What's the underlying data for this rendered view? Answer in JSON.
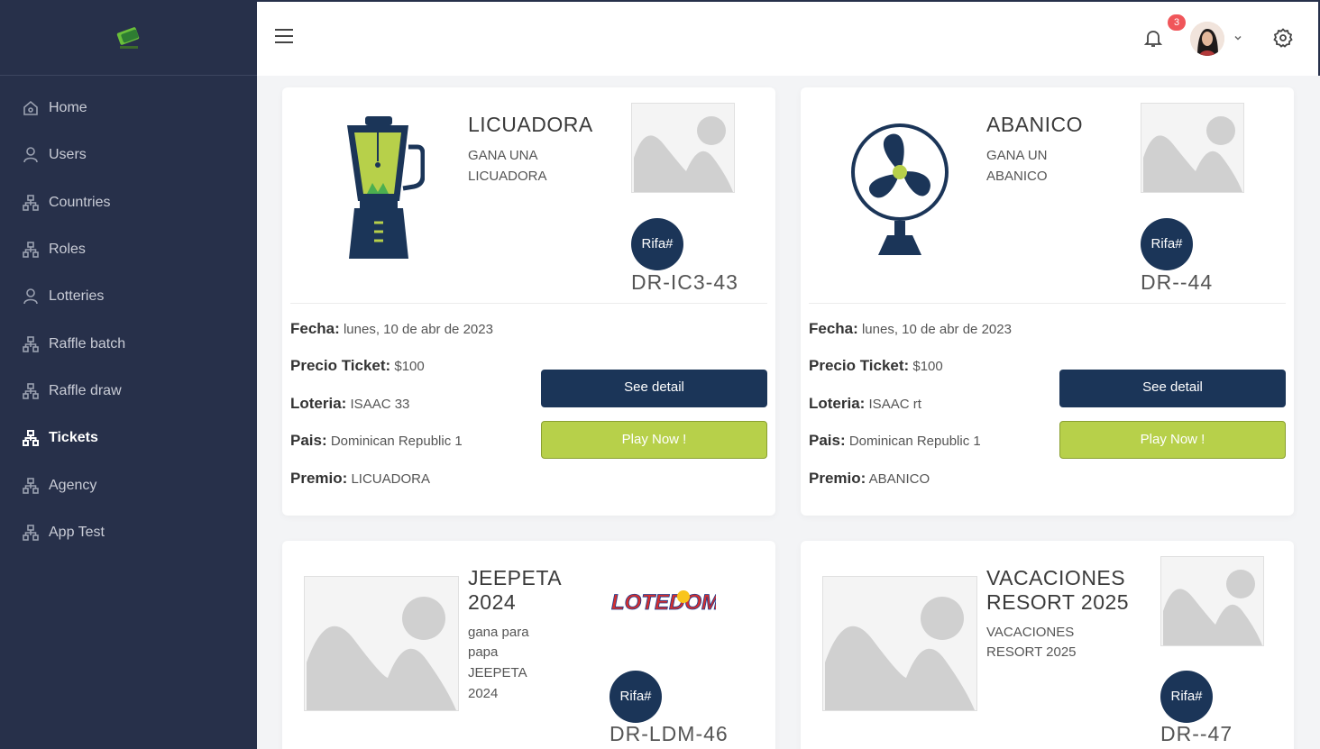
{
  "sidebar": {
    "items": [
      {
        "label": "Home",
        "icon": "home-icon"
      },
      {
        "label": "Users",
        "icon": "user-icon"
      },
      {
        "label": "Countries",
        "icon": "sitemap-icon"
      },
      {
        "label": "Roles",
        "icon": "sitemap-icon"
      },
      {
        "label": "Lotteries",
        "icon": "user-icon"
      },
      {
        "label": "Raffle batch",
        "icon": "sitemap-icon"
      },
      {
        "label": "Raffle draw",
        "icon": "sitemap-icon"
      },
      {
        "label": "Tickets",
        "icon": "sitemap-icon",
        "active": true
      },
      {
        "label": "Agency",
        "icon": "sitemap-icon"
      },
      {
        "label": "App Test",
        "icon": "sitemap-icon"
      }
    ]
  },
  "topbar": {
    "notification_count": "3"
  },
  "cards": [
    {
      "title": "LICUADORA",
      "subtitle_line1": "GANA UNA",
      "subtitle_line2": "LICUADORA",
      "rifa_label": "Rifa#",
      "code": "DR-IC3-43",
      "fecha_label": "Fecha:",
      "fecha": "lunes, 10 de abr de 2023",
      "precio_label": "Precio Ticket:",
      "precio": "$100",
      "loteria_label": "Loteria:",
      "loteria": "ISAAC 33",
      "pais_label": "Pais:",
      "pais": "Dominican Republic 1",
      "premio_label": "Premio:",
      "premio": "LICUADORA",
      "detail_label": "See detail",
      "play_label": "Play Now !"
    },
    {
      "title": "ABANICO",
      "subtitle_line1": "GANA UN",
      "subtitle_line2": "ABANICO",
      "rifa_label": "Rifa#",
      "code": "DR--44",
      "fecha_label": "Fecha:",
      "fecha": "lunes, 10 de abr de 2023",
      "precio_label": "Precio Ticket:",
      "precio": "$100",
      "loteria_label": "Loteria:",
      "loteria": "ISAAC rt",
      "pais_label": "Pais:",
      "pais": "Dominican Republic 1",
      "premio_label": "Premio:",
      "premio": "ABANICO",
      "detail_label": "See detail",
      "play_label": "Play Now !"
    },
    {
      "title_line1": "JEEPETA",
      "title_line2": "2024",
      "subtitle_line1": "gana para",
      "subtitle_line2": "papa",
      "subtitle_line3": "JEEPETA",
      "subtitle_line4": "2024",
      "rifa_label": "Rifa#",
      "code": "DR-LDM-46"
    },
    {
      "title_line1": "VACACIONES",
      "title_line2": "RESORT 2025",
      "subtitle_line1": "VACACIONES",
      "subtitle_line2": "RESORT 2025",
      "rifa_label": "Rifa#",
      "code": "DR--47"
    }
  ],
  "colors": {
    "sidebar_bg": "#27304a",
    "primary": "#1b3558",
    "accent": "#b7d04a",
    "badge": "#f0565a"
  }
}
